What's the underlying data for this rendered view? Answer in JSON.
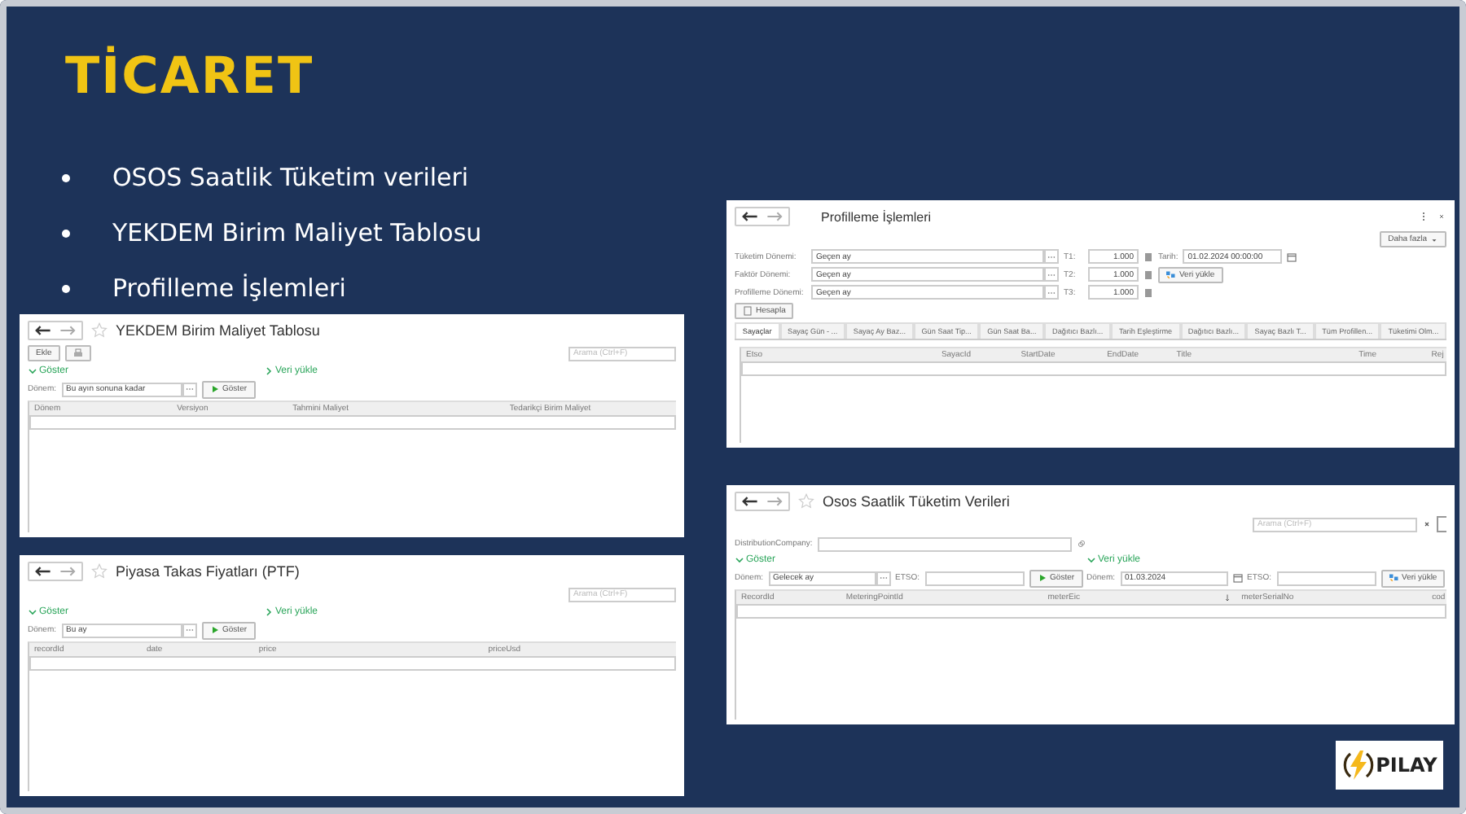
{
  "slide": {
    "title": "TİCARET",
    "bullets": [
      "OSOS Saatlik Tüketim verileri",
      "YEKDEM Birim Maliyet Tablosu",
      "Profilleme İşlemleri"
    ]
  },
  "windows": [
    {
      "kind": "period_grid",
      "title": "YEKDEM Birim Maliyet Tablosu",
      "toolbar_button": "Ekle",
      "search_placeholder": "Arama (Ctrl+F)",
      "sections": [
        {
          "label": "Göster",
          "expanded": true
        },
        {
          "label": "Veri yükle",
          "expanded": false
        }
      ],
      "period_label": "Dönem:",
      "period_value": "Bu ayın sonuna kadar",
      "run_button": "Göster",
      "columns": [
        "Dönem",
        "Versiyon",
        "Tahmini Maliyet",
        "Tedarikçi Birim Maliyet"
      ]
    },
    {
      "kind": "period_grid",
      "title": "Piyasa Takas Fiyatları (PTF)",
      "search_placeholder": "Arama (Ctrl+F)",
      "sections": [
        {
          "label": "Göster",
          "expanded": true
        },
        {
          "label": "Veri yükle",
          "expanded": false
        }
      ],
      "period_label": "Dönem:",
      "period_value": "Bu ay",
      "run_button": "Göster",
      "columns": [
        "recordId",
        "date",
        "price",
        "priceUsd"
      ]
    },
    {
      "kind": "profiling",
      "title": "Profilleme İşlemleri",
      "more_button": "Daha fazla",
      "period_rows": [
        {
          "label": "Tüketim Dönemi:",
          "value": "Geçen ay",
          "t_label": "T1:",
          "t_value": "1.000"
        },
        {
          "label": "Faktör Dönemi:",
          "value": "Geçen ay",
          "t_label": "T2:",
          "t_value": "1.000"
        },
        {
          "label": "Profilleme Dönemi:",
          "value": "Geçen ay",
          "t_label": "T3:",
          "t_value": "1.000"
        }
      ],
      "date_label": "Tarih:",
      "date_value": "01.02.2024 00:00:00",
      "load_button": "Veri yükle",
      "calc_button": "Hesapla",
      "tabs": [
        {
          "label": "Sayaçlar",
          "selected": true
        },
        {
          "label": "Sayaç Gün - ...",
          "selected": false
        },
        {
          "label": "Sayaç Ay Baz...",
          "selected": false
        },
        {
          "label": "Gün Saat Tip...",
          "selected": false
        },
        {
          "label": "Gün Saat Ba...",
          "selected": false
        },
        {
          "label": "Dağıtıcı Bazlı...",
          "selected": false
        },
        {
          "label": "Tarih Eşleştirme",
          "selected": false
        },
        {
          "label": "Dağıtıcı Bazlı...",
          "selected": false
        },
        {
          "label": "Sayaç Bazlı T...",
          "selected": false
        },
        {
          "label": "Tüm Profillen...",
          "selected": false
        },
        {
          "label": "Tüketimi Olm...",
          "selected": false
        }
      ],
      "columns": [
        "Etso",
        "SayacId",
        "StartDate",
        "EndDate",
        "Title",
        "Time",
        "Rej"
      ]
    },
    {
      "kind": "osos",
      "title": "Osos Saatlik Tüketim Verileri",
      "search_placeholder": "Arama (Ctrl+F)",
      "company_label": "DistributionCompany:",
      "sections": [
        {
          "label": "Göster",
          "expanded": true,
          "period_label": "Dönem:",
          "period": {
            "kind": "picker",
            "value": "Gelecek ay"
          },
          "etso_label": "ETSO:",
          "button": {
            "kind": "run",
            "label": "Göster"
          }
        },
        {
          "label": "Veri yükle",
          "expanded": true,
          "period_label": "Dönem:",
          "period": {
            "kind": "date",
            "value": "01.03.2024"
          },
          "etso_label": "ETSO:",
          "button": {
            "kind": "load",
            "label": "Veri yükle"
          }
        }
      ],
      "columns": [
        {
          "label": "RecordId",
          "sorted": false
        },
        {
          "label": "MeteringPointId",
          "sorted": false
        },
        {
          "label": "meterEic",
          "sorted": true
        },
        {
          "label": "meterSerialNo",
          "sorted": false
        },
        {
          "label": "cod",
          "sorted": false
        }
      ]
    }
  ],
  "logo": {
    "text": "PILAY"
  }
}
